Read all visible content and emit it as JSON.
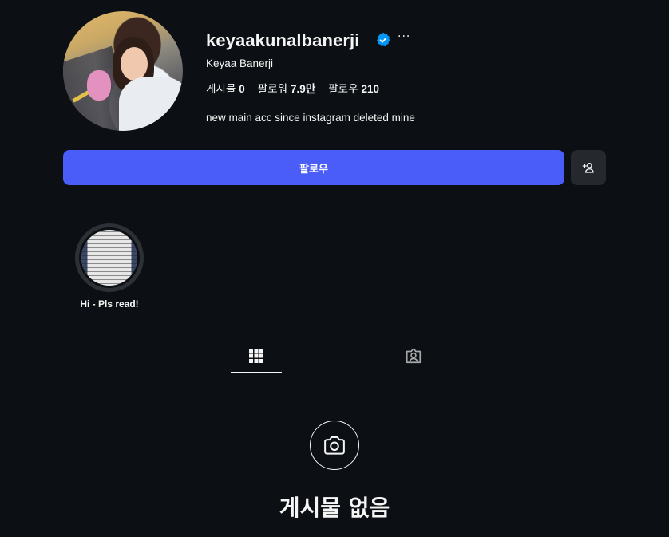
{
  "profile": {
    "username": "keyaakunalbanerji",
    "full_name": "Keyaa Banerji",
    "verified": true,
    "more_label": "···",
    "bio": "new main acc since instagram deleted mine",
    "stats": [
      {
        "label": "게시물",
        "value": "0"
      },
      {
        "label": "팔로워",
        "value": "7.9만"
      },
      {
        "label": "팔로우",
        "value": "210"
      }
    ]
  },
  "actions": {
    "follow_label": "팔로우",
    "add_user_icon": "add-user-icon"
  },
  "highlights": [
    {
      "label": "Hi - Pls read!"
    }
  ],
  "tabs": [
    {
      "icon": "grid-icon",
      "active": true
    },
    {
      "icon": "tagged-icon",
      "active": false
    }
  ],
  "empty_state": {
    "icon": "camera-icon",
    "title": "게시물 없음"
  },
  "colors": {
    "background": "#0c1014",
    "accent": "#4a5df9",
    "verified": "#0095f6",
    "secondary_button": "#25292e"
  }
}
